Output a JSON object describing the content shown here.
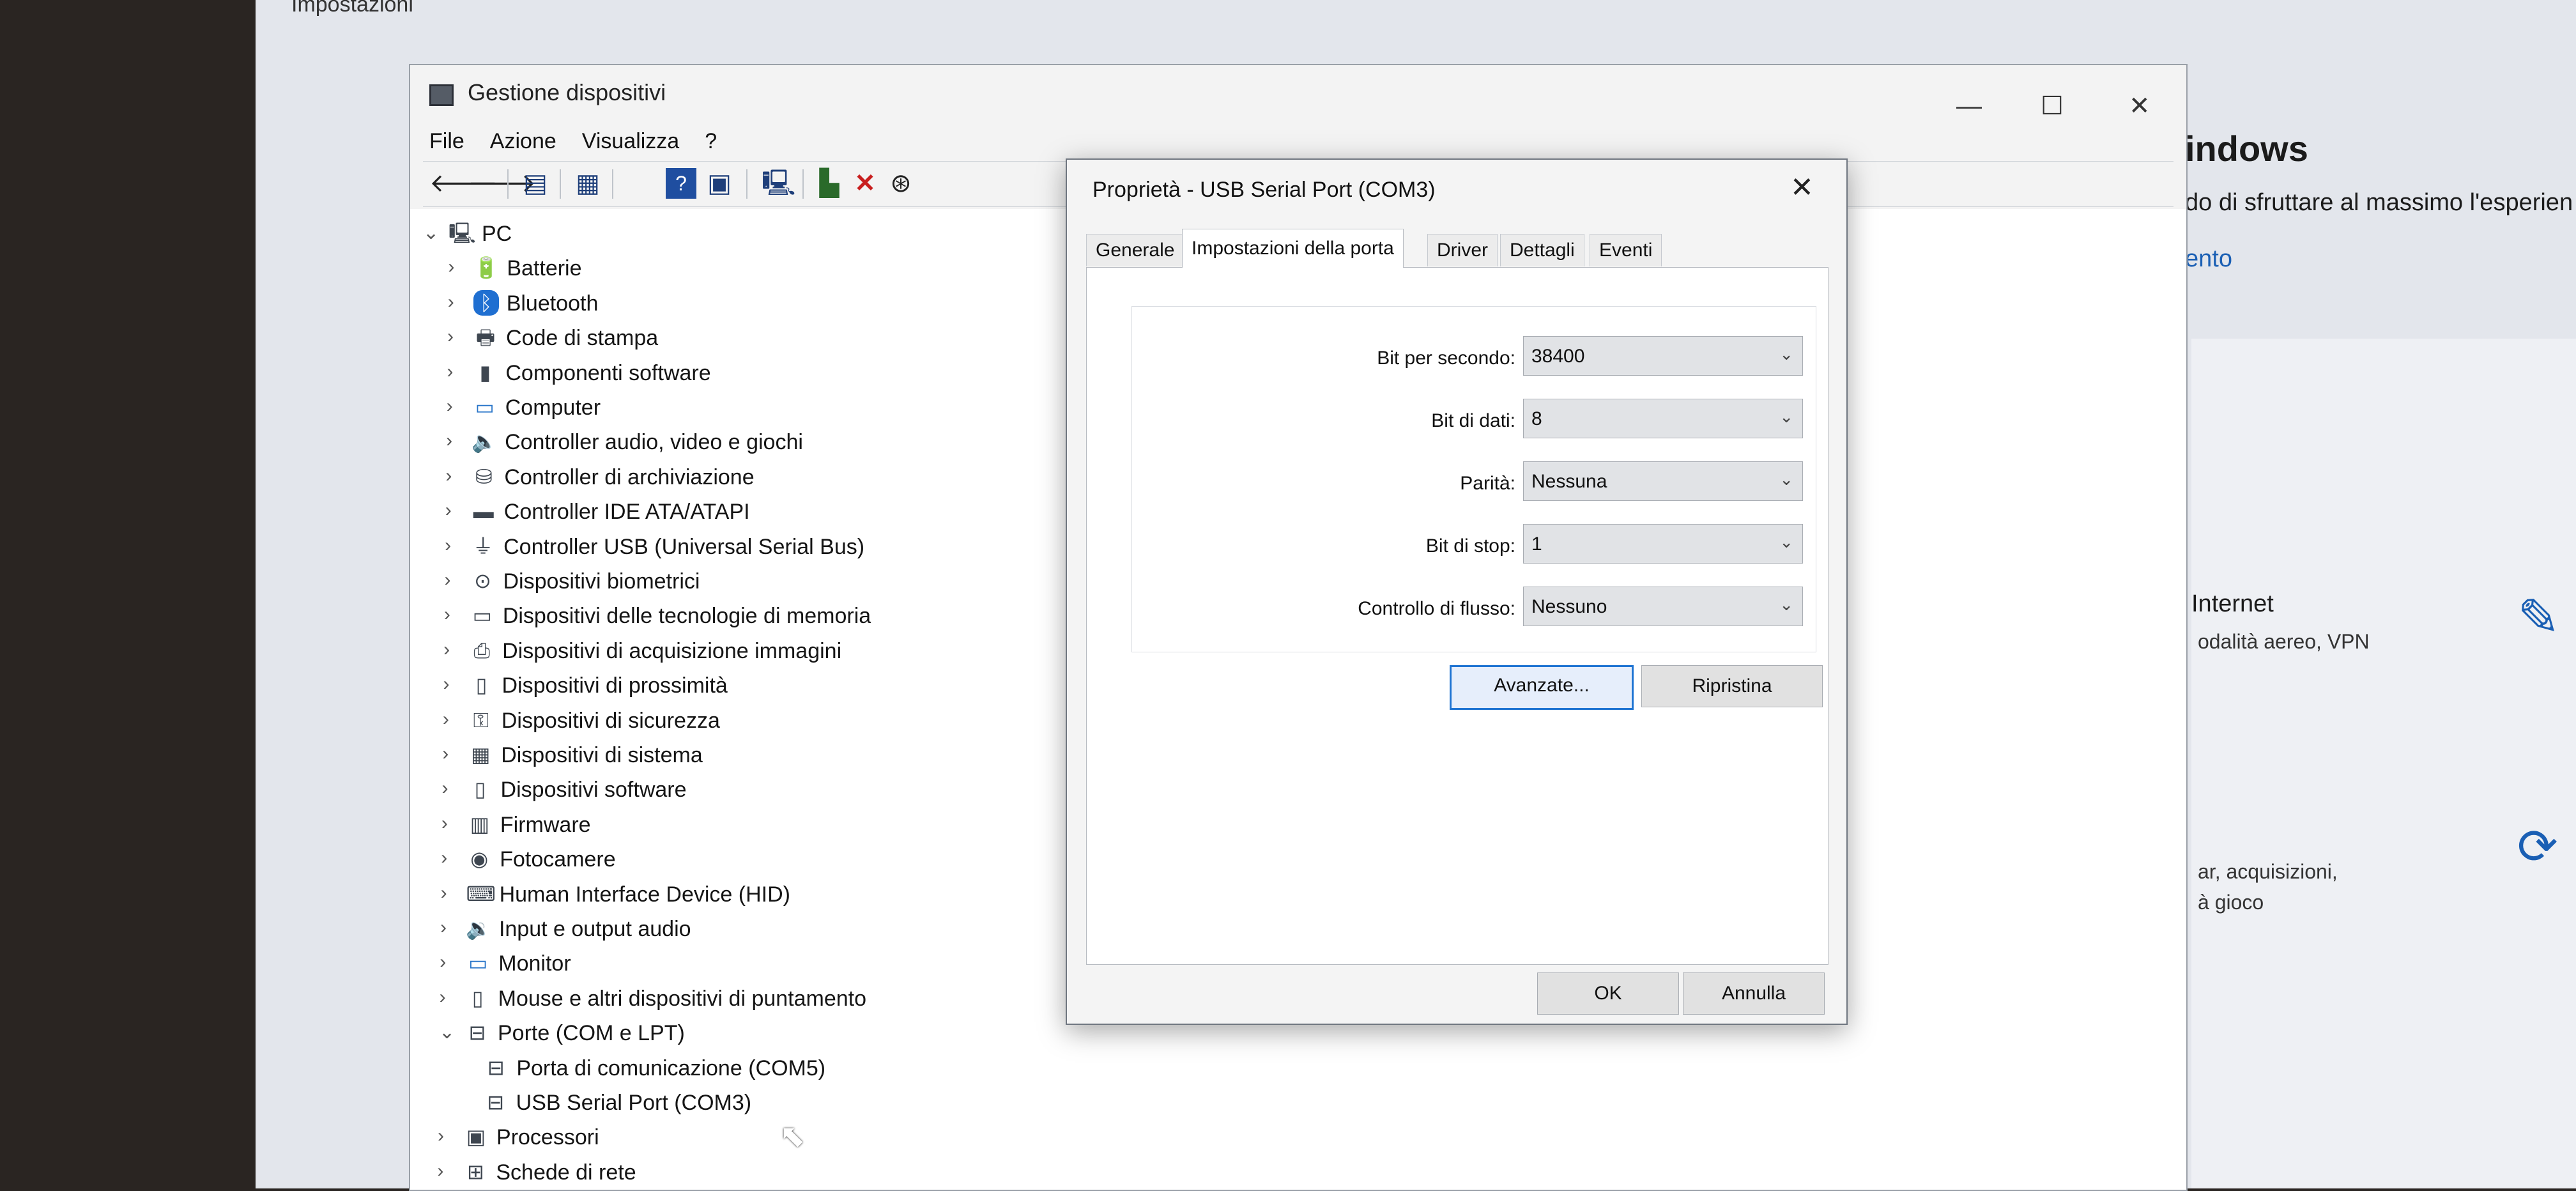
{
  "settings_bg": {
    "title": "Impostazioni",
    "texts": [
      {
        "id": "windows-heading",
        "text": "indows"
      },
      {
        "id": "tagline",
        "text": "do di sfruttare al massimo l'esperien"
      },
      {
        "id": "link",
        "text": "ento"
      },
      {
        "id": "internet-title",
        "text": "Internet"
      },
      {
        "id": "internet-sub",
        "text": "odalità aereo, VPN"
      },
      {
        "id": "update-sub1",
        "text": "ar, acquisizioni,"
      },
      {
        "id": "update-sub2",
        "text": "à gioco"
      }
    ]
  },
  "devmgr": {
    "title": "Gestione dispositivi",
    "window_buttons": {
      "minimize": "—",
      "maximize": "☐",
      "close": "✕"
    },
    "menu": [
      "File",
      "Azione",
      "Visualizza",
      "?"
    ],
    "toolbar_icons": [
      "back-arrow-icon",
      "forward-arrow-icon",
      "properties-icon",
      "show-hidden-icon",
      "help-icon",
      "update-driver-icon",
      "scan-hardware-icon",
      "add-driver-icon",
      "uninstall-icon",
      "disable-device-icon"
    ],
    "tree": [
      {
        "label": "PC",
        "level": 0,
        "expanded": true,
        "icon": "computer-icon"
      },
      {
        "label": "Batterie",
        "level": 1,
        "expanded": false,
        "icon": "battery-icon"
      },
      {
        "label": "Bluetooth",
        "level": 1,
        "expanded": false,
        "icon": "bluetooth-icon"
      },
      {
        "label": "Code di stampa",
        "level": 1,
        "expanded": false,
        "icon": "printer-icon"
      },
      {
        "label": "Componenti software",
        "level": 1,
        "expanded": false,
        "icon": "software-component-icon"
      },
      {
        "label": "Computer",
        "level": 1,
        "expanded": false,
        "icon": "monitor-icon"
      },
      {
        "label": "Controller audio, video e giochi",
        "level": 1,
        "expanded": false,
        "icon": "speaker-icon"
      },
      {
        "label": "Controller di archiviazione",
        "level": 1,
        "expanded": false,
        "icon": "storage-icon"
      },
      {
        "label": "Controller IDE ATA/ATAPI",
        "level": 1,
        "expanded": false,
        "icon": "ide-icon"
      },
      {
        "label": "Controller USB (Universal Serial Bus)",
        "level": 1,
        "expanded": false,
        "icon": "usb-icon"
      },
      {
        "label": "Dispositivi biometrici",
        "level": 1,
        "expanded": false,
        "icon": "biometric-icon"
      },
      {
        "label": "Dispositivi delle tecnologie di memoria",
        "level": 1,
        "expanded": false,
        "icon": "memory-tech-icon"
      },
      {
        "label": "Dispositivi di acquisizione immagini",
        "level": 1,
        "expanded": false,
        "icon": "camera-scanner-icon"
      },
      {
        "label": "Dispositivi di prossimità",
        "level": 1,
        "expanded": false,
        "icon": "proximity-icon"
      },
      {
        "label": "Dispositivi di sicurezza",
        "level": 1,
        "expanded": false,
        "icon": "security-icon"
      },
      {
        "label": "Dispositivi di sistema",
        "level": 1,
        "expanded": false,
        "icon": "system-device-icon"
      },
      {
        "label": "Dispositivi software",
        "level": 1,
        "expanded": false,
        "icon": "software-device-icon"
      },
      {
        "label": "Firmware",
        "level": 1,
        "expanded": false,
        "icon": "firmware-icon"
      },
      {
        "label": "Fotocamere",
        "level": 1,
        "expanded": false,
        "icon": "webcam-icon"
      },
      {
        "label": "Human Interface Device (HID)",
        "level": 1,
        "expanded": false,
        "icon": "hid-icon"
      },
      {
        "label": "Input e output audio",
        "level": 1,
        "expanded": false,
        "icon": "audio-io-icon"
      },
      {
        "label": "Monitor",
        "level": 1,
        "expanded": false,
        "icon": "display-icon"
      },
      {
        "label": "Mouse e altri dispositivi di puntamento",
        "level": 1,
        "expanded": false,
        "icon": "mouse-icon"
      },
      {
        "label": "Porte (COM e LPT)",
        "level": 1,
        "expanded": true,
        "icon": "port-icon"
      },
      {
        "label": "Porta di comunicazione (COM5)",
        "level": 2,
        "expanded": null,
        "icon": "port-icon"
      },
      {
        "label": "USB Serial Port (COM3)",
        "level": 2,
        "expanded": null,
        "icon": "port-icon"
      },
      {
        "label": "Processori",
        "level": 1,
        "expanded": false,
        "icon": "processor-icon"
      },
      {
        "label": "Schede di rete",
        "level": 1,
        "expanded": false,
        "icon": "network-adapter-icon"
      }
    ]
  },
  "props": {
    "title": "Proprietà - USB Serial Port (COM3)",
    "close": "✕",
    "tabs": [
      "Generale",
      "Impostazioni della porta",
      "Driver",
      "Dettagli",
      "Eventi"
    ],
    "active_tab": 1,
    "fields": [
      {
        "label": "Bit per secondo:",
        "value": "38400"
      },
      {
        "label": "Bit di dati:",
        "value": "8"
      },
      {
        "label": "Parità:",
        "value": "Nessuna"
      },
      {
        "label": "Bit di stop:",
        "value": "1"
      },
      {
        "label": "Controllo di flusso:",
        "value": "Nessuno"
      }
    ],
    "advanced_label": "Avanzate...",
    "restore_label": "Ripristina",
    "ok_label": "OK",
    "cancel_label": "Annulla"
  }
}
